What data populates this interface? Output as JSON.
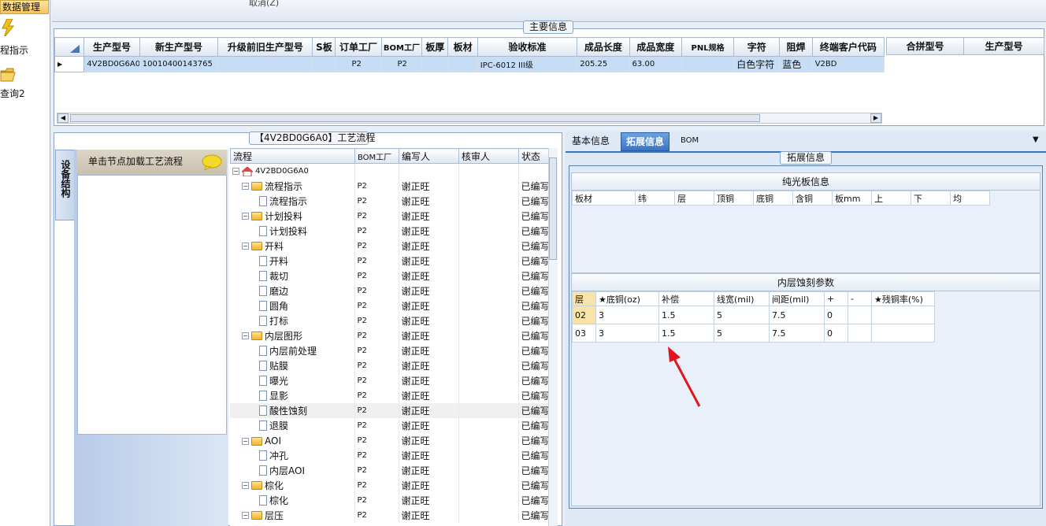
{
  "left_rail": {
    "title": "数据管理",
    "items": [
      {
        "label": "程指示",
        "icon": "lightning-icon"
      },
      {
        "label": "查询2",
        "icon": "folder-open-icon"
      }
    ]
  },
  "top_strip": {
    "cancel_label": "取消(Z)"
  },
  "main_info": {
    "title": "主要信息",
    "columns": [
      "生产型号",
      "新生产型号",
      "升级前旧生产型号",
      "S板",
      "订单工厂",
      "BOM工厂",
      "板厚",
      "板材",
      "验收标准",
      "成品长度",
      "成品宽度",
      "PNL规格",
      "字符",
      "阻焊",
      "终端客户代码"
    ],
    "row": [
      "4V2BD0G6A0",
      "10010400143765",
      "",
      "",
      "P2",
      "P2",
      "",
      "",
      "IPC-6012 III级",
      "205.25",
      "63.00",
      "",
      "白色字符",
      "蓝色",
      "V2BD"
    ],
    "side_columns": [
      "合拼型号",
      "生产型号"
    ]
  },
  "flow": {
    "title": "【4V2BD0G6A0】工艺流程",
    "side_tab": "设备结构",
    "load_label": "单击节点加载工艺流程",
    "columns": [
      "流程",
      "BOM工厂",
      "编写人",
      "核审人",
      "状态"
    ],
    "root": "4V2BD0G6A0",
    "rows": [
      {
        "name": "流程指示",
        "level": 1,
        "type": "folder",
        "bom": "P2",
        "author": "谢正旺",
        "status": "已编写"
      },
      {
        "name": "流程指示",
        "level": 2,
        "type": "doc",
        "bom": "P2",
        "author": "谢正旺",
        "status": "已编写"
      },
      {
        "name": "计划投料",
        "level": 1,
        "type": "folder",
        "bom": "P2",
        "author": "谢正旺",
        "status": "已编写"
      },
      {
        "name": "计划投料",
        "level": 2,
        "type": "doc",
        "bom": "P2",
        "author": "谢正旺",
        "status": "已编写"
      },
      {
        "name": "开料",
        "level": 1,
        "type": "folder",
        "bom": "P2",
        "author": "谢正旺",
        "status": "已编写"
      },
      {
        "name": "开料",
        "level": 2,
        "type": "doc",
        "bom": "P2",
        "author": "谢正旺",
        "status": "已编写"
      },
      {
        "name": "裁切",
        "level": 2,
        "type": "doc",
        "bom": "P2",
        "author": "谢正旺",
        "status": "已编写"
      },
      {
        "name": "磨边",
        "level": 2,
        "type": "doc",
        "bom": "P2",
        "author": "谢正旺",
        "status": "已编写"
      },
      {
        "name": "圆角",
        "level": 2,
        "type": "doc",
        "bom": "P2",
        "author": "谢正旺",
        "status": "已编写"
      },
      {
        "name": "打标",
        "level": 2,
        "type": "doc",
        "bom": "P2",
        "author": "谢正旺",
        "status": "已编写"
      },
      {
        "name": "内层图形",
        "level": 1,
        "type": "folder",
        "bom": "P2",
        "author": "谢正旺",
        "status": "已编写"
      },
      {
        "name": "内层前处理",
        "level": 2,
        "type": "doc",
        "bom": "P2",
        "author": "谢正旺",
        "status": "已编写"
      },
      {
        "name": "贴膜",
        "level": 2,
        "type": "doc",
        "bom": "P2",
        "author": "谢正旺",
        "status": "已编写"
      },
      {
        "name": "曝光",
        "level": 2,
        "type": "doc",
        "bom": "P2",
        "author": "谢正旺",
        "status": "已编写"
      },
      {
        "name": "显影",
        "level": 2,
        "type": "doc",
        "bom": "P2",
        "author": "谢正旺",
        "status": "已编写"
      },
      {
        "name": "酸性蚀刻",
        "level": 2,
        "type": "doc",
        "bom": "P2",
        "author": "谢正旺",
        "status": "已编写",
        "highlight": true
      },
      {
        "name": "退膜",
        "level": 2,
        "type": "doc",
        "bom": "P2",
        "author": "谢正旺",
        "status": "已编写"
      },
      {
        "name": "AOI",
        "level": 1,
        "type": "folder",
        "bom": "P2",
        "author": "谢正旺",
        "status": "已编写"
      },
      {
        "name": "冲孔",
        "level": 2,
        "type": "doc",
        "bom": "P2",
        "author": "谢正旺",
        "status": "已编写"
      },
      {
        "name": "内层AOI",
        "level": 2,
        "type": "doc",
        "bom": "P2",
        "author": "谢正旺",
        "status": "已编写"
      },
      {
        "name": "棕化",
        "level": 1,
        "type": "folder",
        "bom": "P2",
        "author": "谢正旺",
        "status": "已编写"
      },
      {
        "name": "棕化",
        "level": 2,
        "type": "doc",
        "bom": "P2",
        "author": "谢正旺",
        "status": "已编写"
      },
      {
        "name": "层压",
        "level": 1,
        "type": "folder",
        "bom": "P2",
        "author": "谢正旺",
        "status": "已编写"
      }
    ]
  },
  "right": {
    "tabs": [
      "基本信息",
      "拓展信息",
      "BOM"
    ],
    "group_title": "拓展信息",
    "plain_board": {
      "title": "纯光板信息",
      "columns": [
        "板材",
        "纬",
        "层",
        "顶铜",
        "底铜",
        "含铜",
        "板mm",
        "上",
        "下",
        "均"
      ]
    },
    "inner_etch": {
      "title": "内层蚀刻参数",
      "columns": [
        "层",
        "★底铜(oz)",
        "补偿",
        "线宽(mil)",
        "间距(mil)",
        "+",
        "-",
        "★残铜率(%)"
      ],
      "rows": [
        [
          "02",
          "3",
          "1.5",
          "5",
          "7.5",
          "0",
          "",
          ""
        ],
        [
          "03",
          "3",
          "1.5",
          "5",
          "7.5",
          "0",
          "",
          ""
        ]
      ]
    }
  },
  "colors": {
    "accent": "#3c74c4",
    "selection": "#c7dcf5",
    "arrow": "#e0161c"
  }
}
